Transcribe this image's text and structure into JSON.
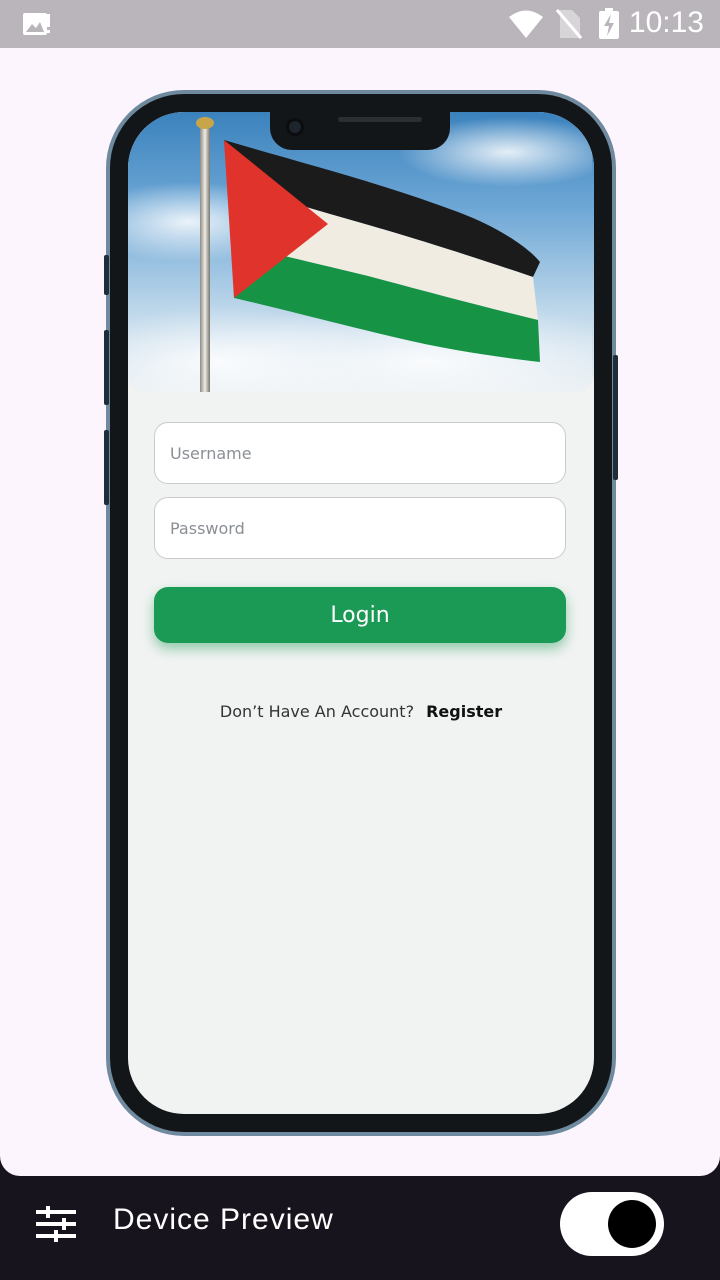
{
  "status_bar": {
    "time": "10:13",
    "icons": [
      "gallery-notification-icon",
      "wifi-icon",
      "no-sim-icon",
      "battery-charging-icon"
    ]
  },
  "app": {
    "flag_image": "palestine-flag-icon",
    "username": {
      "value": "",
      "placeholder": "Username"
    },
    "password": {
      "value": "",
      "placeholder": "Password"
    },
    "login_label": "Login",
    "register_prompt": "Don’t Have An Account?",
    "register_link": "Register",
    "colors": {
      "accent": "#1b9a55",
      "screen_bg": "#f1f3f2"
    }
  },
  "device_preview": {
    "label": "Device Preview",
    "settings_icon": "tune-icon",
    "toggle_on": true
  }
}
